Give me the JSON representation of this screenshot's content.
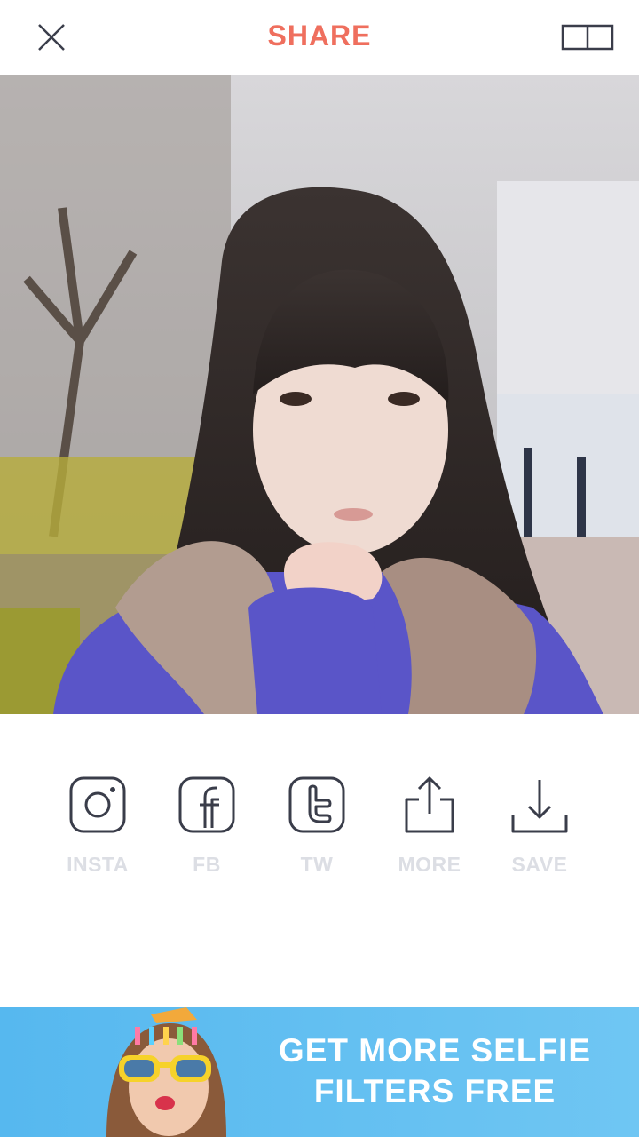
{
  "header": {
    "title": "SHARE"
  },
  "share": {
    "items": [
      {
        "label": "INSTA",
        "icon": "instagram-icon"
      },
      {
        "label": "FB",
        "icon": "facebook-icon"
      },
      {
        "label": "TW",
        "icon": "twitter-icon"
      },
      {
        "label": "MORE",
        "icon": "share-more-icon"
      },
      {
        "label": "SAVE",
        "icon": "download-icon"
      }
    ]
  },
  "banner": {
    "line1": "GET MORE SELFIE",
    "line2": "FILTERS FREE"
  },
  "colors": {
    "accent": "#ef6f5e",
    "icon_stroke": "#3a3d4a",
    "label_gray": "#dcdee4",
    "banner_blue": "#5cbcf0"
  }
}
